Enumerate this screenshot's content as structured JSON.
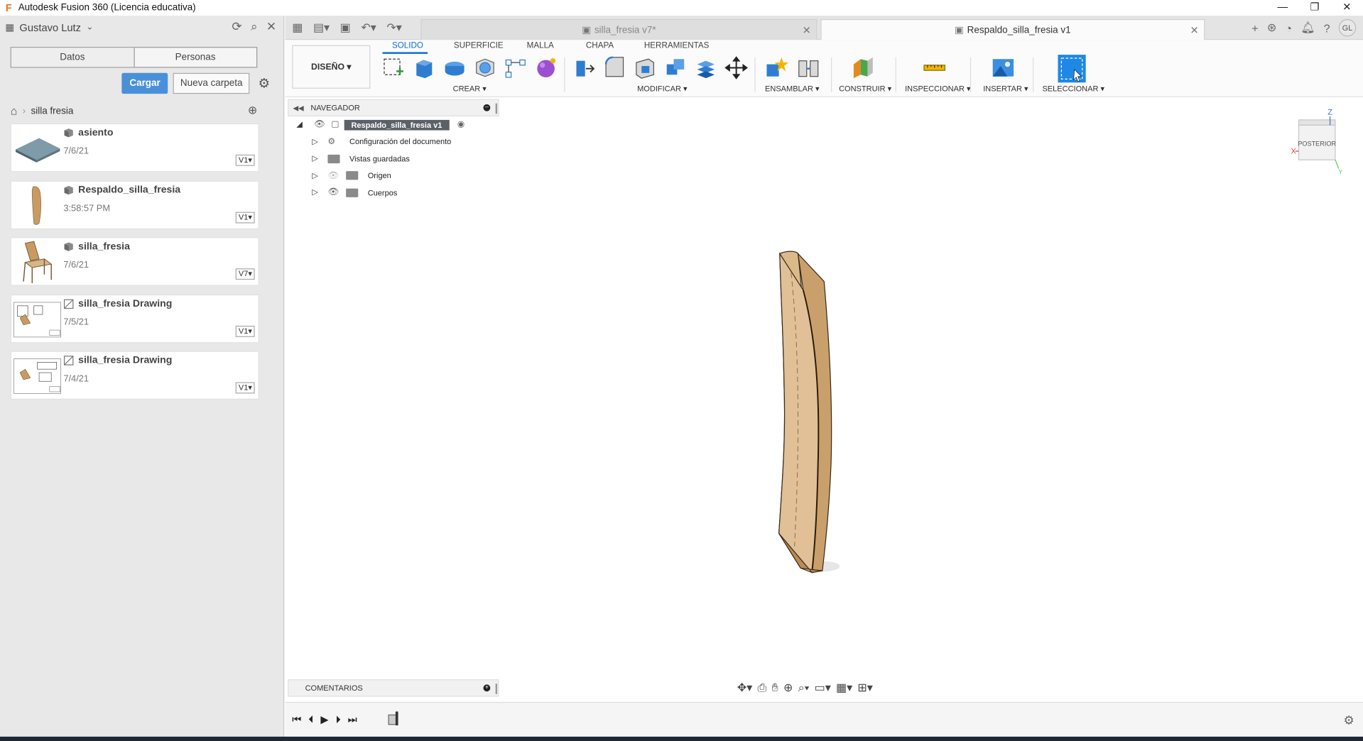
{
  "window": {
    "title": "Autodesk Fusion 360 (Licencia educativa)",
    "controls": [
      "—",
      "❐",
      "✕"
    ]
  },
  "data_panel": {
    "user": "Gustavo Lutz",
    "segments": [
      "Datos",
      "Personas"
    ],
    "upload_label": "Cargar",
    "new_folder_label": "Nueva carpeta",
    "breadcrumb": "silla fresia",
    "files": [
      {
        "name": "asiento",
        "date": "7/6/21",
        "version": "V1"
      },
      {
        "name": "Respaldo_silla_fresia",
        "date": "3:58:57 PM",
        "version": "V1"
      },
      {
        "name": "silla_fresia",
        "date": "7/6/21",
        "version": "V7"
      },
      {
        "name": "silla_fresia Drawing",
        "date": "7/5/21",
        "version": "V1"
      },
      {
        "name": "silla_fresia Drawing",
        "date": "7/4/21",
        "version": "V1"
      }
    ]
  },
  "tabs": [
    {
      "label": "silla_fresia v7*",
      "active": false
    },
    {
      "label": "Respaldo_silla_fresia v1",
      "active": true
    }
  ],
  "user_initials": "GL",
  "ribbon": {
    "workspace": "DISEÑO",
    "tabs": [
      "SOLIDO",
      "SUPERFICIE",
      "MALLA",
      "CHAPA",
      "HERRAMIENTAS"
    ],
    "active_tab": "SOLIDO",
    "groups": [
      "CREAR",
      "MODIFICAR",
      "ENSAMBLAR",
      "CONSTRUIR",
      "INSPECCIONAR",
      "INSERTAR",
      "SELECCIONAR"
    ]
  },
  "browser": {
    "title": "NAVEGADOR",
    "root": "Respaldo_silla_fresia v1",
    "items": [
      "Configuración del documento",
      "Vistas guardadas",
      "Origen",
      "Cuerpos"
    ]
  },
  "comments_label": "COMENTARIOS",
  "viewcube": {
    "face": "POSTERIOR",
    "axes": [
      "Z",
      "X",
      "Y"
    ]
  },
  "colors": {
    "accent": "#0a6ed1",
    "primary_button": "#4a90d9",
    "wood": "#d8b180",
    "select_tool": "#1e88e5"
  }
}
